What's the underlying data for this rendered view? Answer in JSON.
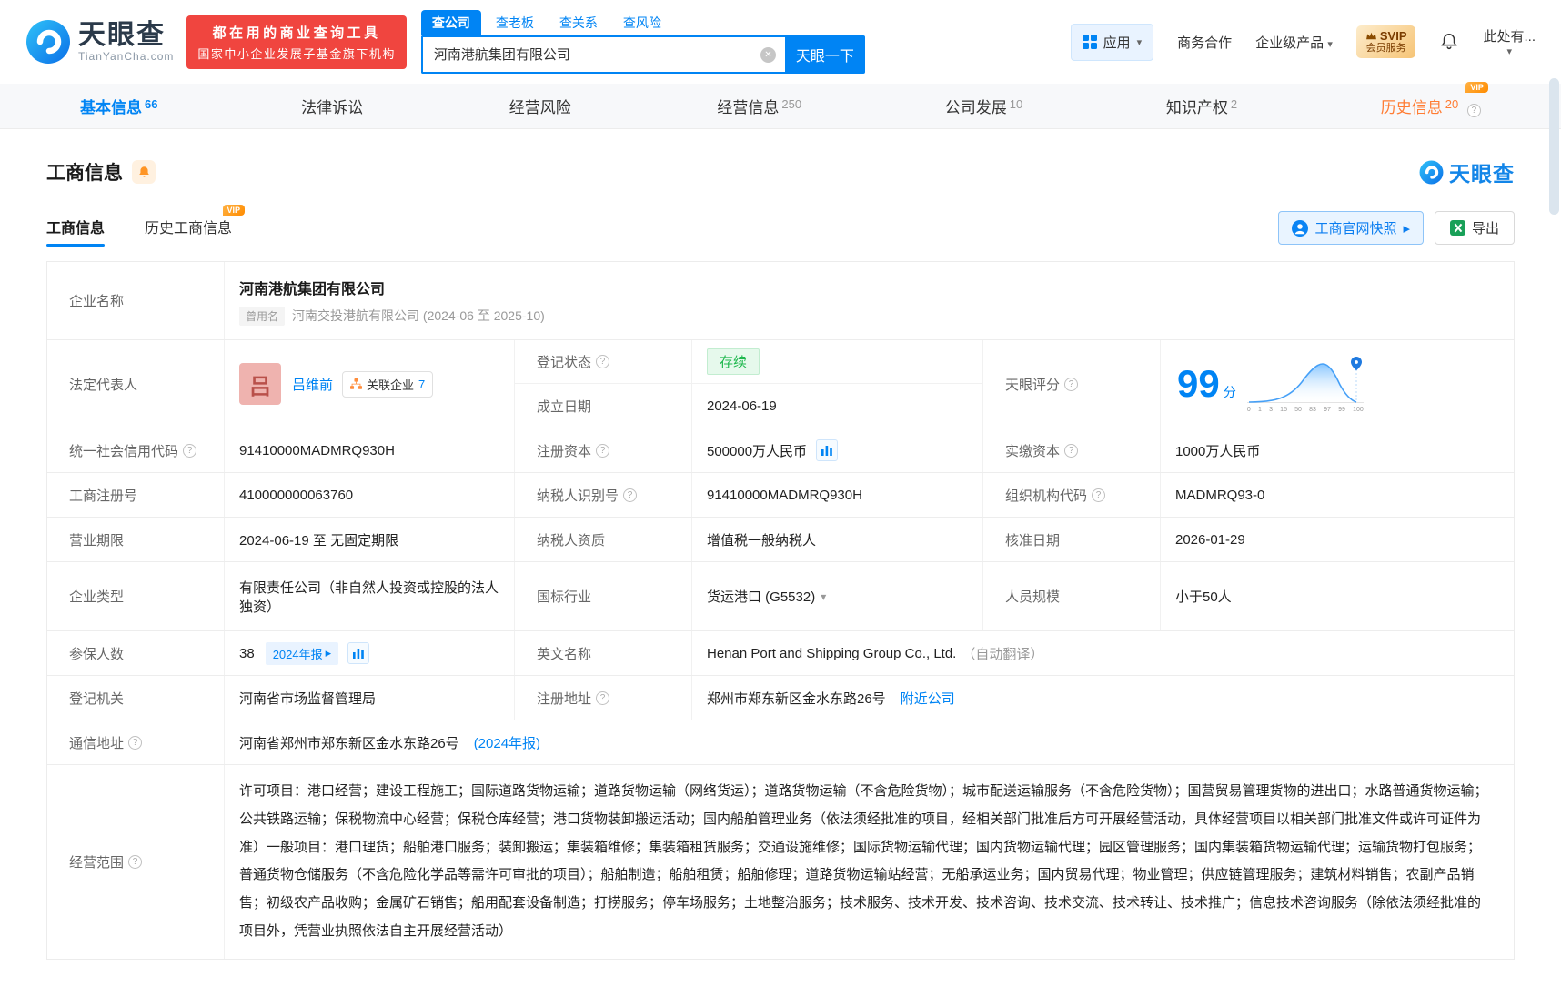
{
  "icons": {
    "caret_down": "▾",
    "arrow_right": "▸",
    "help": "?",
    "clear": "✕"
  },
  "header": {
    "logo": {
      "name_cn": "天眼查",
      "name_en": "TianYanCha.com"
    },
    "banner": {
      "line1": "都在用的商业查询工具",
      "line2": "国家中小企业发展子基金旗下机构"
    },
    "search": {
      "tabs": [
        {
          "label": "查公司"
        },
        {
          "label": "查老板"
        },
        {
          "label": "查关系"
        },
        {
          "label": "查风险"
        }
      ],
      "value": "河南港航集团有限公司",
      "submit_label": "天眼一下"
    },
    "right": {
      "apps": "应用",
      "cooperation": "商务合作",
      "enterprise": "企业级产品",
      "svip_line1": "SVIP",
      "svip_line2": "会员服务",
      "more": "此处有..."
    }
  },
  "nav": {
    "tabs": [
      {
        "label": "基本信息",
        "count": "66"
      },
      {
        "label": "法律诉讼",
        "count": ""
      },
      {
        "label": "经营风险",
        "count": ""
      },
      {
        "label": "经营信息",
        "count": "250"
      },
      {
        "label": "公司发展",
        "count": "10"
      },
      {
        "label": "知识产权",
        "count": "2"
      },
      {
        "label": "历史信息",
        "count": "20",
        "vip": "VIP"
      }
    ]
  },
  "section": {
    "title": "工商信息",
    "watermark": "天眼查"
  },
  "subtabs": {
    "business": "工商信息",
    "history": "历史工商信息",
    "vip": "VIP"
  },
  "actions": {
    "snapshot": "工商官网快照",
    "export": "导出"
  },
  "table": {
    "company_name_label": "企业名称",
    "company_name": "河南港航集团有限公司",
    "former_name_badge": "曾用名",
    "former_name": "河南交投港航有限公司 (2024-06 至 2025-10)",
    "legal_rep_label": "法定代表人",
    "legal_rep_avatar": "吕",
    "legal_rep_name": "吕维前",
    "related_companies_label": "关联企业",
    "related_companies_count": "7",
    "reg_status_label": "登记状态",
    "reg_status": "存续",
    "establish_date_label": "成立日期",
    "establish_date": "2024-06-19",
    "score_label": "天眼评分",
    "score": "99",
    "score_unit": "分",
    "score_chart": {
      "ticks": [
        "0",
        "1",
        "3",
        "15",
        "50",
        "83",
        "97",
        "99",
        "100"
      ]
    },
    "credit_code_label": "统一社会信用代码",
    "credit_code": "91410000MADMRQ930H",
    "reg_capital_label": "注册资本",
    "reg_capital": "500000万人民币",
    "paid_capital_label": "实缴资本",
    "paid_capital": "1000万人民币",
    "reg_number_label": "工商注册号",
    "reg_number": "410000000063760",
    "taxpayer_id_label": "纳税人识别号",
    "taxpayer_id": "91410000MADMRQ930H",
    "org_code_label": "组织机构代码",
    "org_code": "MADMRQ93-0",
    "business_term_label": "营业期限",
    "business_term": "2024-06-19 至 无固定期限",
    "taxpayer_quality_label": "纳税人资质",
    "taxpayer_quality": "增值税一般纳税人",
    "approval_date_label": "核准日期",
    "approval_date": "2026-01-29",
    "company_type_label": "企业类型",
    "company_type": "有限责任公司（非自然人投资或控股的法人独资）",
    "industry_label": "国标行业",
    "industry": "货运港口 (G5532)",
    "staff_size_label": "人员规模",
    "staff_size": "小于50人",
    "insured_label": "参保人数",
    "insured_count": "38",
    "insured_badge": "2024年报",
    "english_name_label": "英文名称",
    "english_name": "Henan Port and Shipping Group Co., Ltd.",
    "english_name_note": "（自动翻译）",
    "reg_authority_label": "登记机关",
    "reg_authority": "河南省市场监督管理局",
    "reg_address_label": "注册地址",
    "reg_address": "郑州市郑东新区金水东路26号",
    "nearby_link": "附近公司",
    "mail_address_label": "通信地址",
    "mail_address": "河南省郑州市郑东新区金水东路26号",
    "mail_address_link": "(2024年报)",
    "business_scope_label": "经营范围",
    "business_scope": "许可项目：港口经营；建设工程施工；国际道路货物运输；道路货物运输（网络货运）；道路货物运输（不含危险货物）；城市配送运输服务（不含危险货物）；国营贸易管理货物的进出口；水路普通货物运输；公共铁路运输；保税物流中心经营；保税仓库经营；港口货物装卸搬运活动；国内船舶管理业务（依法须经批准的项目，经相关部门批准后方可开展经营活动，具体经营项目以相关部门批准文件或许可证件为准）一般项目：港口理货；船舶港口服务；装卸搬运；集装箱维修；集装箱租赁服务；交通设施维修；国际货物运输代理；国内货物运输代理；园区管理服务；国内集装箱货物运输代理；运输货物打包服务；普通货物仓储服务（不含危险化学品等需许可审批的项目）；船舶制造；船舶租赁；船舶修理；道路货物运输站经营；无船承运业务；国内贸易代理；物业管理；供应链管理服务；建筑材料销售；农副产品销售；初级农产品收购；金属矿石销售；船用配套设备制造；打捞服务；停车场服务；土地整治服务；技术服务、技术开发、技术咨询、技术交流、技术转让、技术推广；信息技术咨询服务（除依法须经批准的项目外，凭营业执照依法自主开展经营活动）"
  }
}
